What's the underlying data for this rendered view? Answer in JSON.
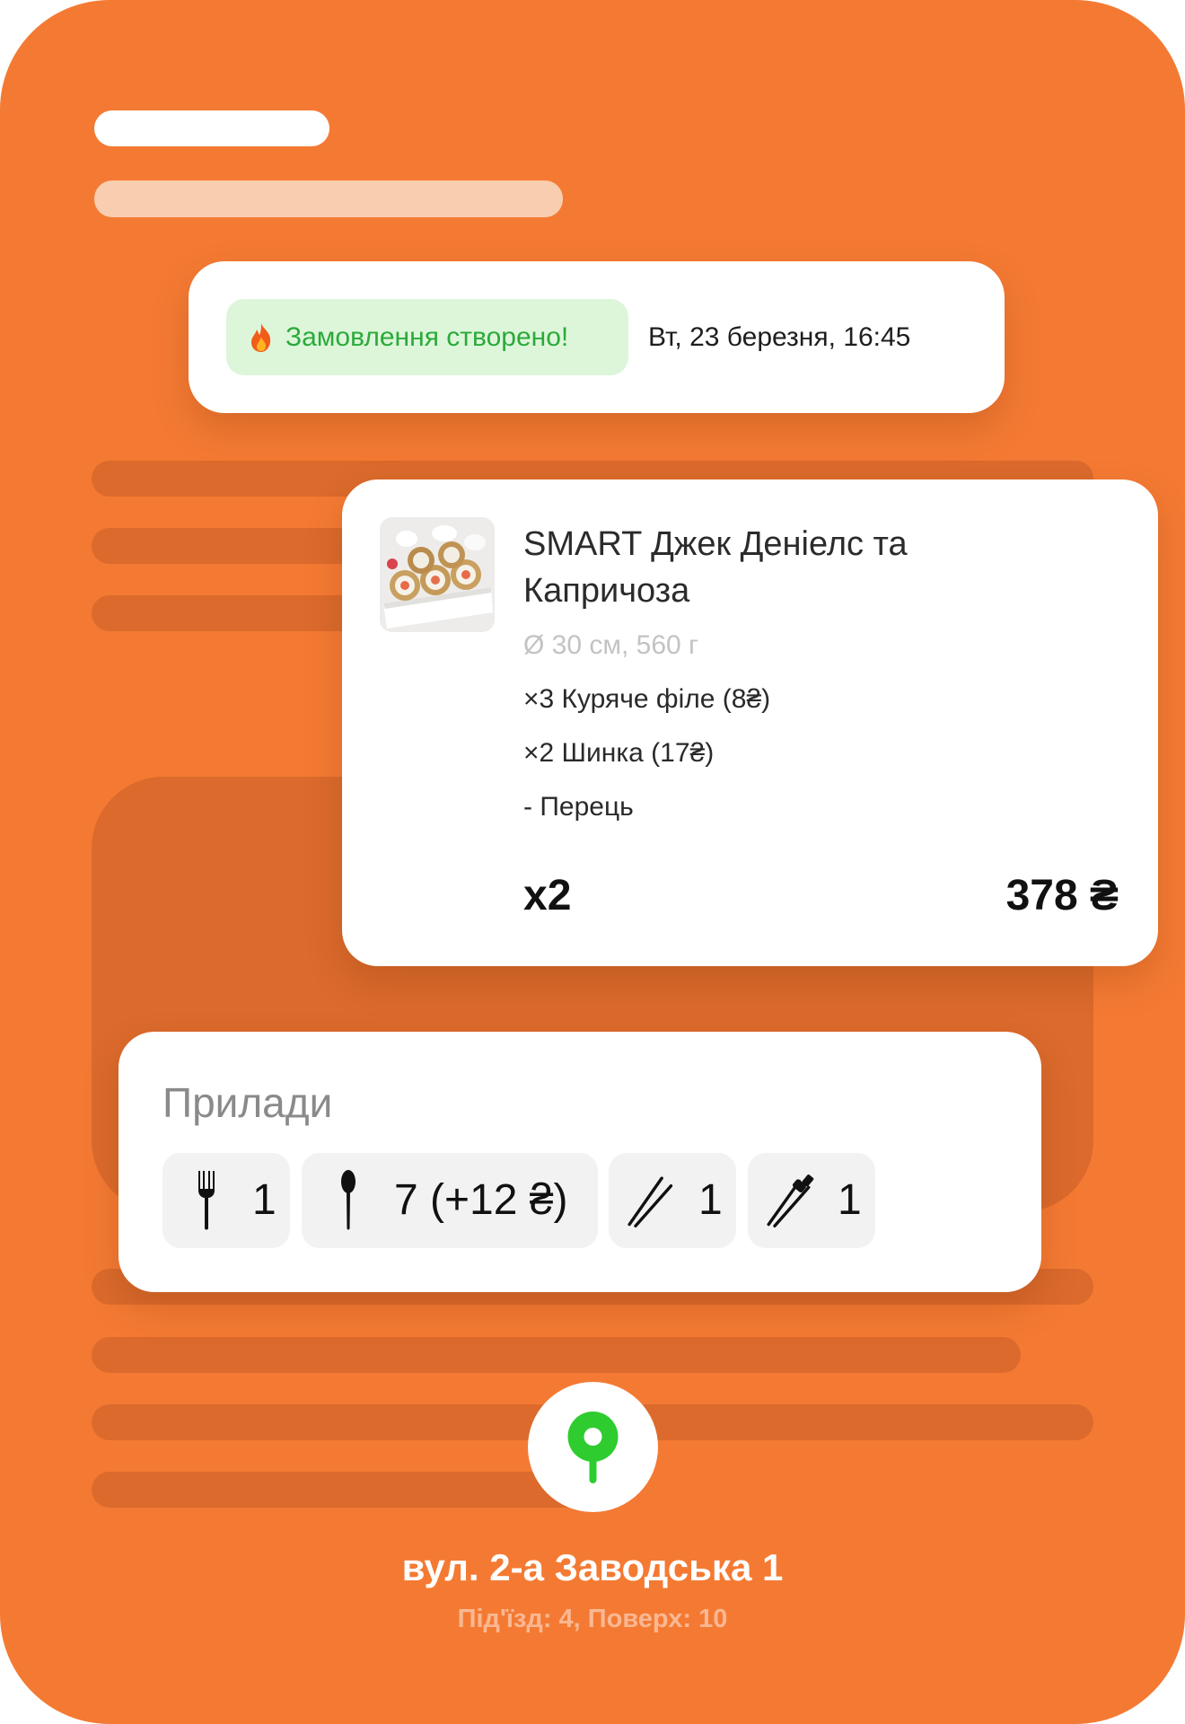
{
  "colors": {
    "background": "#F47A33",
    "card": "#FFFFFF",
    "success": "#2BAA3A",
    "success_bg": "#DDF6DA",
    "pin": "#2ECC2E"
  },
  "status": {
    "icon": "fire-icon",
    "label": "Замовлення створено!",
    "datetime": "Вт, 23 березня, 16:45"
  },
  "product": {
    "image": "sushi-roll-photo",
    "title": "SMART Джек Деніелс та Капричоза",
    "meta": "Ø 30 см, 560 г",
    "modifiers": [
      "×3 Куряче філе (8₴)",
      "×2 Шинка (17₴)",
      "- Перець"
    ],
    "quantity": "x2",
    "price": "378 ₴"
  },
  "utensils": {
    "title": "Прилади",
    "items": [
      {
        "icon": "fork-icon",
        "count": "1"
      },
      {
        "icon": "spoon-icon",
        "count": "7 (+12 ₴)"
      },
      {
        "icon": "chopsticks-icon",
        "count": "1"
      },
      {
        "icon": "training-chopsticks-icon",
        "count": "1"
      }
    ]
  },
  "address": {
    "icon": "location-pin-icon",
    "street": "вул. 2-а Заводська 1",
    "details": "Під'їзд: 4, Поверх: 10"
  }
}
